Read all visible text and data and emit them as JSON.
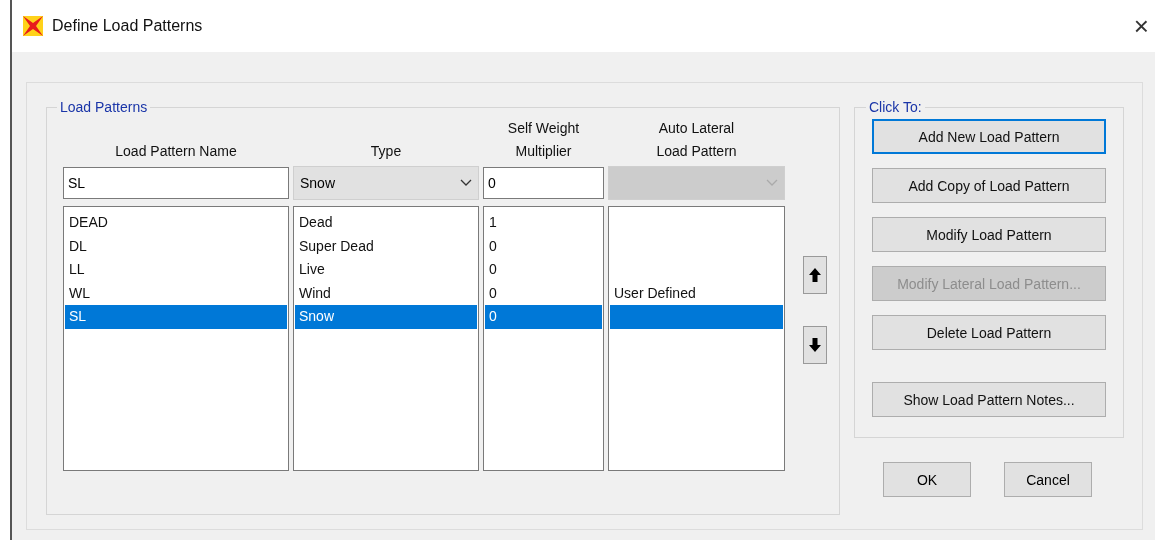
{
  "window": {
    "title": "Define Load Patterns",
    "close": "×"
  },
  "load_patterns": {
    "title": "Load Patterns",
    "columns": [
      "Load Pattern Name",
      "Type",
      "Self Weight\nMultiplier",
      "Auto Lateral\nLoad Pattern"
    ],
    "editor": {
      "name": "SL",
      "type": "Snow",
      "multiplier": "0",
      "auto_lateral_disabled": true
    },
    "rows": [
      {
        "name": "DEAD",
        "type": "Dead",
        "multiplier": "1",
        "selected": false
      },
      {
        "name": "DL",
        "type": "Super Dead",
        "multiplier": "0",
        "selected": false
      },
      {
        "name": "LL",
        "type": "Live",
        "multiplier": "0",
        "selected": false
      },
      {
        "name": "WL",
        "type": "Wind",
        "multiplier": "0",
        "auto_lateral": "User Defined",
        "selected": false
      },
      {
        "name": "SL",
        "type": "Snow",
        "multiplier": "0",
        "selected": true
      }
    ]
  },
  "click_to": {
    "title": "Click To:",
    "buttons": [
      {
        "label": "Add New Load Pattern",
        "disabled": false,
        "default": true
      },
      {
        "label": "Add Copy of Load Pattern",
        "disabled": false,
        "default": false
      },
      {
        "label": "Modify Load Pattern",
        "disabled": false,
        "default": false
      },
      {
        "label": "Modify Lateral Load Pattern...",
        "disabled": true,
        "default": false
      },
      {
        "label": "Delete Load Pattern",
        "disabled": false,
        "default": false
      },
      {
        "label": "Show Load Pattern Notes...",
        "disabled": false,
        "default": false
      }
    ]
  },
  "footer_buttons": [
    "OK",
    "Cancel"
  ]
}
